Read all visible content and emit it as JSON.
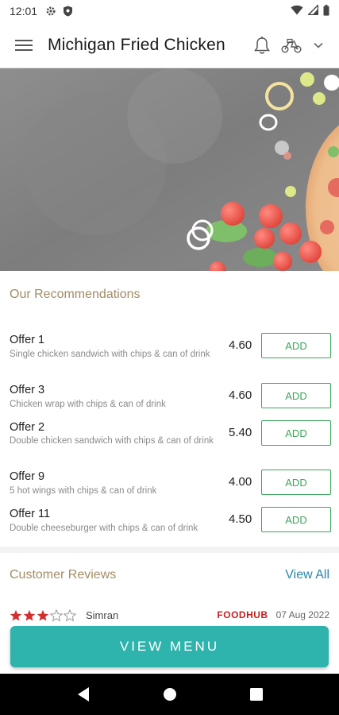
{
  "status_bar": {
    "time": "12:01",
    "icons": [
      "gear-icon",
      "shield-icon",
      "wifi-icon",
      "signal-icon",
      "battery-icon"
    ]
  },
  "app_bar": {
    "title": "Michigan Fried Chicken",
    "icons": [
      "hamburger-menu-icon",
      "bell-icon",
      "delivery-scooter-icon",
      "chevron-down-icon"
    ]
  },
  "hero": {
    "image": "food-banner-image"
  },
  "recommendations": {
    "title": "Our Recommendations",
    "items": [
      {
        "name": "Offer 1",
        "description": "Single chicken sandwich with chips & can of drink",
        "price": "4.60",
        "add_label": "ADD"
      },
      {
        "name": "Offer 3",
        "description": "Chicken wrap with chips & can of drink",
        "price": "4.60",
        "add_label": "ADD"
      },
      {
        "name": "Offer 2",
        "description": "Double chicken sandwich with chips & can of drink",
        "price": "5.40",
        "add_label": "ADD"
      },
      {
        "name": "Offer 9",
        "description": "5 hot wings with chips & can of drink",
        "price": "4.00",
        "add_label": "ADD"
      },
      {
        "name": "Offer 11",
        "description": "Double cheeseburger with chips & can of drink",
        "price": "4.50",
        "add_label": "ADD"
      }
    ]
  },
  "reviews": {
    "title": "Customer Reviews",
    "view_all": "View All",
    "first": {
      "rating": 3,
      "max": 5,
      "name": "Simran",
      "platform": "FOODHUB",
      "date": "07 Aug 2022"
    }
  },
  "cta": {
    "label": "VIEW MENU"
  },
  "nav": {
    "icons": [
      "back-icon",
      "home-icon",
      "recents-icon"
    ]
  },
  "colors": {
    "accent": "#2eb3ad",
    "add_green": "#3aa55a",
    "section_gold": "#a28c66",
    "link_blue": "#2a85a8",
    "star_red": "#d32f2f"
  }
}
